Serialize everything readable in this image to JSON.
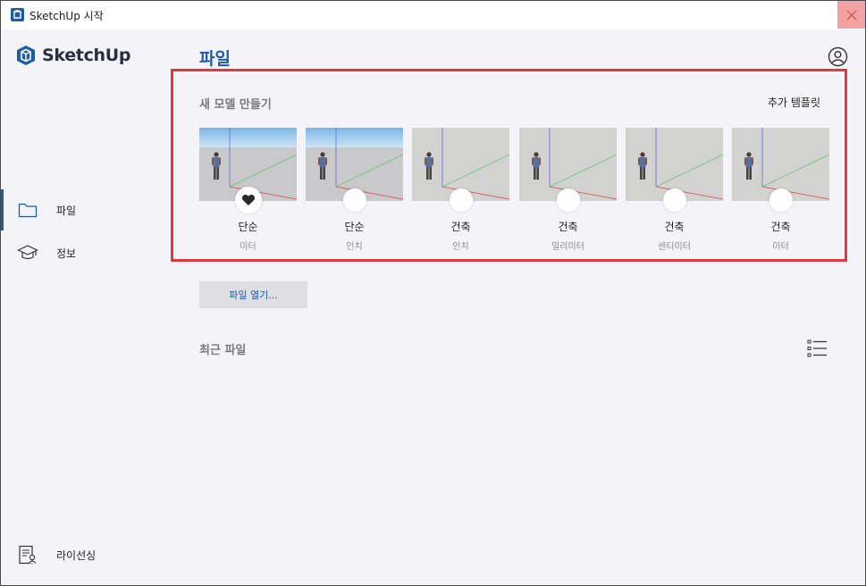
{
  "window": {
    "title": "SketchUp 시작"
  },
  "sidebar": {
    "logo_text": "SketchUp",
    "items": [
      {
        "label": "파일",
        "icon": "folder-icon",
        "active": true
      },
      {
        "label": "정보",
        "icon": "graduation-cap-icon",
        "active": false
      }
    ],
    "license": {
      "label": "라이선싱",
      "icon": "license-icon"
    }
  },
  "main": {
    "title": "파일",
    "new_model": {
      "title": "새 모델 만들기",
      "more_templates": "추가 템플릿",
      "templates": [
        {
          "name": "단순",
          "unit": "미터",
          "sky": true,
          "favorite": true
        },
        {
          "name": "단순",
          "unit": "인치",
          "sky": true,
          "favorite": false
        },
        {
          "name": "건축",
          "unit": "인치",
          "sky": false,
          "favorite": false
        },
        {
          "name": "건축",
          "unit": "밀리미터",
          "sky": false,
          "favorite": false
        },
        {
          "name": "건축",
          "unit": "센티미터",
          "sky": false,
          "favorite": false
        },
        {
          "name": "건축",
          "unit": "미터",
          "sky": false,
          "favorite": false
        }
      ]
    },
    "open_file_label": "파일 열기...",
    "recent_files_title": "최근 파일"
  },
  "colors": {
    "accent": "#1e5ca8",
    "highlight_border": "#e0393e",
    "close_hover": "#f1a3a3",
    "background": "#f4f4f8"
  }
}
